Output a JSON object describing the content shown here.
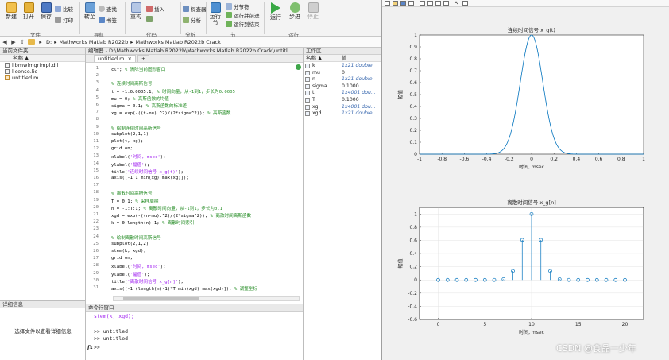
{
  "ribbon": {
    "buttons": [
      {
        "label": "新建",
        "icon": "new-icon"
      },
      {
        "label": "打开",
        "icon": "open-icon"
      },
      {
        "label": "保存",
        "icon": "save-icon"
      },
      {
        "label": "转至",
        "icon": "goto-icon"
      },
      {
        "label": "重构",
        "icon": "refactor-icon"
      },
      {
        "label": "运行节",
        "icon": "run-section-icon"
      },
      {
        "label": "运行",
        "icon": "run-icon"
      },
      {
        "label": "步进",
        "icon": "step-icon"
      },
      {
        "label": "停止",
        "icon": "stop-icon"
      }
    ],
    "small": {
      "compare": "比较",
      "print": "打印",
      "find": "查找",
      "bookmark": "书签",
      "insert": "插入",
      "profiler": "探查器",
      "analyze": "分析",
      "section_break": "分节符",
      "run_advance": "运行并前进",
      "run_to_end": "运行到结束"
    },
    "groups": [
      "文件",
      "导航",
      "代码",
      "分析",
      "节",
      "运行"
    ]
  },
  "address": {
    "path": [
      "D:",
      "Mathworks Matlab R2022b",
      "Mathworks Matlab R2022b Crack"
    ]
  },
  "folder": {
    "title": "当前文件夹",
    "column": "名称 ▲",
    "files": [
      "libmwlmgrimpl.dll",
      "license.lic",
      "untitled.m"
    ]
  },
  "details": {
    "title": "详细信息",
    "message": "选择文件以查看详细信息"
  },
  "editor": {
    "title": "编辑器 - D:\\Mathworks Matlab R2022b\\Mathworks Matlab R2022b Crack\\untitl...",
    "tab": "untitled.m",
    "tab_close": "×",
    "tab_add": "+",
    "lines": [
      {
        "n": "1",
        "parts": [
          [
            "clf; ",
            "c"
          ],
          [
            "% 清除当前图形窗口",
            "cm"
          ]
        ]
      },
      {
        "n": "2",
        "parts": []
      },
      {
        "n": "3",
        "parts": [
          [
            "% 连续时间高斯信号",
            "cm"
          ]
        ]
      },
      {
        "n": "4",
        "parts": [
          [
            "t = -1:0.0005:1; ",
            "c"
          ],
          [
            "% 时间向量，从-1到1，步长为0.0005",
            "cm"
          ]
        ]
      },
      {
        "n": "5",
        "parts": [
          [
            "mu = 0; ",
            "c"
          ],
          [
            "% 高斯函数的均值",
            "cm"
          ]
        ]
      },
      {
        "n": "6",
        "parts": [
          [
            "sigma = 0.1; ",
            "c"
          ],
          [
            "% 高斯函数的标准差",
            "cm"
          ]
        ]
      },
      {
        "n": "7",
        "parts": [
          [
            "xg = exp(-((t-mu).^2)/(2*sigma^2)); ",
            "c"
          ],
          [
            "% 高斯函数",
            "cm"
          ]
        ]
      },
      {
        "n": "8",
        "parts": []
      },
      {
        "n": "9",
        "parts": [
          [
            "% 绘制连续时间高斯信号",
            "cm"
          ]
        ]
      },
      {
        "n": "10",
        "parts": [
          [
            "subplot(2,1,1)",
            "c"
          ]
        ]
      },
      {
        "n": "11",
        "parts": [
          [
            "plot(t, xg);",
            "c"
          ]
        ]
      },
      {
        "n": "12",
        "parts": [
          [
            "grid on;",
            "c"
          ]
        ]
      },
      {
        "n": "13",
        "parts": [
          [
            "xlabel(",
            "c"
          ],
          [
            "'时间, msec'",
            "st"
          ],
          [
            ");",
            "c"
          ]
        ]
      },
      {
        "n": "14",
        "parts": [
          [
            "ylabel(",
            "c"
          ],
          [
            "'幅值'",
            "st"
          ],
          [
            ");",
            "c"
          ]
        ]
      },
      {
        "n": "15",
        "parts": [
          [
            "title(",
            "c"
          ],
          [
            "'连续时间信号 x_g(t)'",
            "st"
          ],
          [
            ");",
            "c"
          ]
        ]
      },
      {
        "n": "16",
        "parts": [
          [
            "axis([-1 1 min(xg) max(xg)]);",
            "c"
          ]
        ]
      },
      {
        "n": "17",
        "parts": []
      },
      {
        "n": "18",
        "parts": [
          [
            "% 离散时间高斯信号",
            "cm"
          ]
        ]
      },
      {
        "n": "19",
        "parts": [
          [
            "T = 0.1; ",
            "c"
          ],
          [
            "% 采样周期",
            "cm"
          ]
        ]
      },
      {
        "n": "20",
        "parts": [
          [
            "n = -1:T:1; ",
            "c"
          ],
          [
            "% 离散时间向量，从-1到1，步长为0.1",
            "cm"
          ]
        ]
      },
      {
        "n": "21",
        "parts": [
          [
            "xgd = exp(-((n-mu).^2)/(2*sigma^2)); ",
            "c"
          ],
          [
            "% 离散时间高斯函数",
            "cm"
          ]
        ]
      },
      {
        "n": "22",
        "parts": [
          [
            "k = 0:length(n)-1; ",
            "c"
          ],
          [
            "% 离散时间索引",
            "cm"
          ]
        ]
      },
      {
        "n": "23",
        "parts": []
      },
      {
        "n": "24",
        "parts": [
          [
            "% 绘制离散时间高斯信号",
            "cm"
          ]
        ]
      },
      {
        "n": "25",
        "parts": [
          [
            "subplot(2,1,2)",
            "c"
          ]
        ]
      },
      {
        "n": "26",
        "parts": [
          [
            "stem(k, xgd);",
            "c"
          ]
        ]
      },
      {
        "n": "27",
        "parts": [
          [
            "grid on;",
            "c"
          ]
        ]
      },
      {
        "n": "28",
        "parts": [
          [
            "xlabel(",
            "c"
          ],
          [
            "'时间, msec'",
            "st"
          ],
          [
            ");",
            "c"
          ]
        ]
      },
      {
        "n": "29",
        "parts": [
          [
            "ylabel(",
            "c"
          ],
          [
            "'幅值'",
            "st"
          ],
          [
            ");",
            "c"
          ]
        ]
      },
      {
        "n": "30",
        "parts": [
          [
            "title(",
            "c"
          ],
          [
            "'离散时间信号 x_g[n]'",
            "st"
          ],
          [
            ");",
            "c"
          ]
        ]
      },
      {
        "n": "31",
        "parts": [
          [
            "axis([-1 (length(n)-1)*T min(xgd) max(xgd)]); ",
            "c"
          ],
          [
            "% 调整坐标",
            "cm"
          ]
        ]
      }
    ]
  },
  "command": {
    "title": "命令行窗口",
    "lines": [
      "stem(k, xgd);",
      "",
      ">> untitled",
      ">> untitled"
    ],
    "prompt": ">>",
    "fx": "fx"
  },
  "workspace": {
    "title": "工作区",
    "col_name": "名称 ▲",
    "col_value": "值",
    "vars": [
      {
        "name": "k",
        "value": "1x21 double",
        "blue": true
      },
      {
        "name": "mu",
        "value": "0",
        "blue": false
      },
      {
        "name": "n",
        "value": "1x21 double",
        "blue": true
      },
      {
        "name": "sigma",
        "value": "0.1000",
        "blue": false
      },
      {
        "name": "t",
        "value": "1x4001 dou...",
        "blue": true
      },
      {
        "name": "T",
        "value": "0.1000",
        "blue": false
      },
      {
        "name": "xg",
        "value": "1x4001 dou...",
        "blue": true
      },
      {
        "name": "xgd",
        "value": "1x21 double",
        "blue": true
      }
    ]
  },
  "watermark": "CSDN @食品一少年",
  "chart_data": [
    {
      "type": "line",
      "title": "连续时间信号 x_g(t)",
      "xlabel": "时间, msec",
      "ylabel": "幅值",
      "xlim": [
        -1,
        1
      ],
      "ylim": [
        0,
        1
      ],
      "xticks": [
        "-1",
        "-0.8",
        "-0.6",
        "-0.4",
        "-0.2",
        "0",
        "0.2",
        "0.4",
        "0.6",
        "0.8",
        "1"
      ],
      "yticks": [
        "0",
        "0.1",
        "0.2",
        "0.3",
        "0.4",
        "0.5",
        "0.6",
        "0.7",
        "0.8",
        "0.9",
        "1"
      ],
      "grid": false,
      "series": [
        {
          "mu": 0,
          "sigma": 0.1,
          "color": "#0072bd"
        }
      ]
    },
    {
      "type": "stem",
      "title": "离散时间信号 x_g[n]",
      "xlabel": "时间, msec",
      "ylabel": "幅值",
      "xlim": [
        -2,
        22
      ],
      "ylim": [
        -0.6,
        1.1
      ],
      "xticks": [
        "0",
        "5",
        "10",
        "15",
        "20"
      ],
      "yticks": [
        "-0.6",
        "-0.4",
        "-0.2",
        "0",
        "0.2",
        "0.4",
        "0.6",
        "0.8",
        "1"
      ],
      "grid": true,
      "x": [
        0,
        1,
        2,
        3,
        4,
        5,
        6,
        7,
        8,
        9,
        10,
        11,
        12,
        13,
        14,
        15,
        16,
        17,
        18,
        19,
        20
      ],
      "values": [
        0.0,
        0.0,
        0.0,
        0.0,
        0.0,
        0.0,
        0.0003,
        0.0111,
        0.1353,
        0.6065,
        1.0,
        0.6065,
        0.1353,
        0.0111,
        0.0003,
        0.0,
        0.0,
        0.0,
        0.0,
        0.0,
        0.0
      ],
      "color": "#0072bd"
    }
  ]
}
